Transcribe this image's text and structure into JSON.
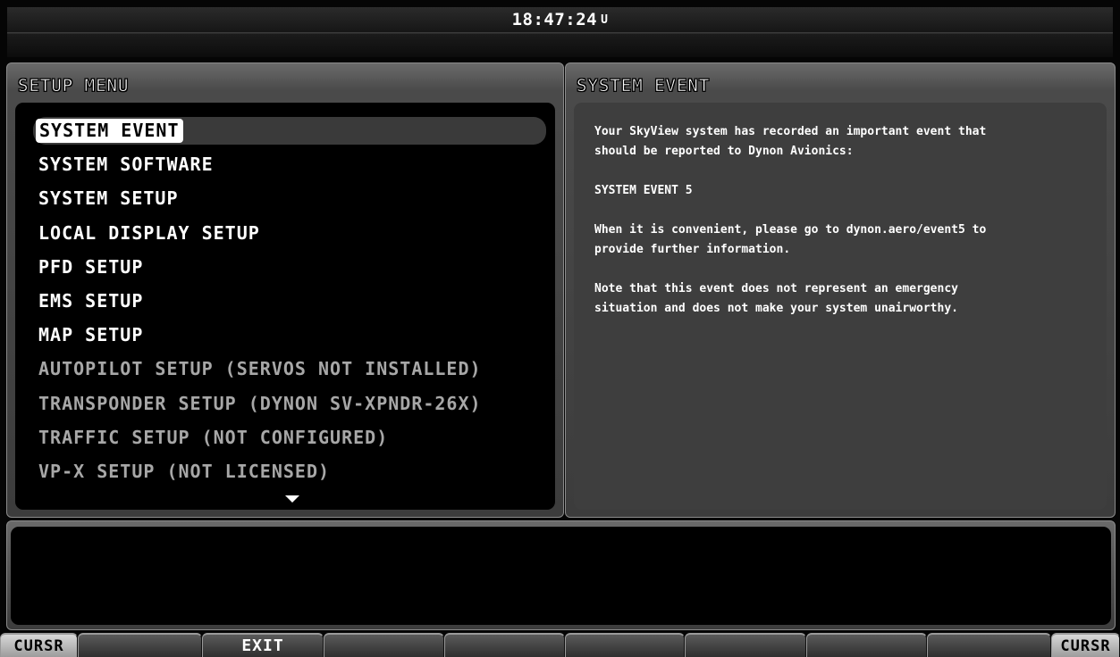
{
  "header": {
    "time": "18:47:24",
    "time_suffix": "U"
  },
  "setup_menu": {
    "title": "SETUP MENU",
    "items": [
      {
        "label": "SYSTEM EVENT",
        "state": "selected"
      },
      {
        "label": "SYSTEM SOFTWARE",
        "state": "enabled"
      },
      {
        "label": "SYSTEM SETUP",
        "state": "enabled"
      },
      {
        "label": "LOCAL DISPLAY SETUP",
        "state": "enabled"
      },
      {
        "label": "PFD SETUP",
        "state": "enabled"
      },
      {
        "label": "EMS SETUP",
        "state": "enabled"
      },
      {
        "label": "MAP SETUP",
        "state": "enabled"
      },
      {
        "label": "AUTOPILOT SETUP (SERVOS NOT INSTALLED)",
        "state": "disabled"
      },
      {
        "label": "TRANSPONDER SETUP (DYNON SV-XPNDR-26X)",
        "state": "disabled"
      },
      {
        "label": "TRAFFIC SETUP (NOT CONFIGURED)",
        "state": "disabled"
      },
      {
        "label": "VP-X SETUP (NOT LICENSED)",
        "state": "disabled"
      }
    ],
    "scroll_icon": "triangle-down-icon"
  },
  "system_event": {
    "title": "SYSTEM EVENT",
    "text": "Your SkyView system has recorded an important event that\nshould be reported to Dynon Avionics:\n\nSYSTEM EVENT 5\n\nWhen it is convenient, please go to dynon.aero/event5 to\nprovide further information.\n\nNote that this event does not represent an emergency\nsituation and does not make your system unairworthy."
  },
  "softkeys": {
    "left_cursor": "CURSR",
    "keys": [
      "",
      "EXIT",
      "",
      "",
      "",
      "",
      "",
      ""
    ],
    "right_cursor": "CURSR"
  },
  "colors": {
    "background": "#000000",
    "panel_bezel": "#4a4a4a",
    "text": "#ffffff",
    "disabled_text": "#a7a7a7",
    "info_background": "#3e3e3e"
  }
}
